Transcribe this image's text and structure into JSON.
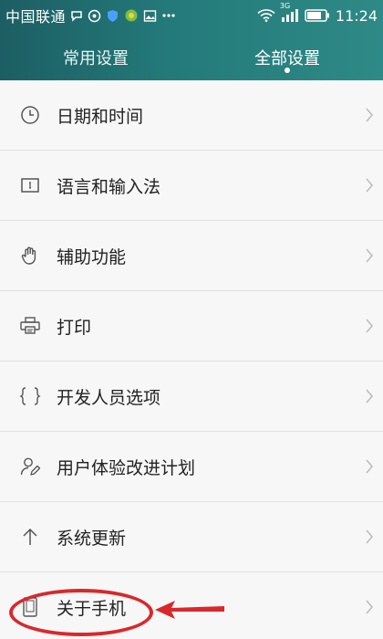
{
  "status_bar": {
    "carrier": "中国联通",
    "network": "3G",
    "time": "11:24"
  },
  "tabs": [
    {
      "label": "常用设置",
      "active": false
    },
    {
      "label": "全部设置",
      "active": true
    }
  ],
  "settings_list": [
    {
      "label": "日期和时间",
      "icon": "clock-icon"
    },
    {
      "label": "语言和输入法",
      "icon": "keyboard-icon"
    },
    {
      "label": "辅助功能",
      "icon": "hand-icon"
    },
    {
      "label": "打印",
      "icon": "printer-icon"
    },
    {
      "label": "开发人员选项",
      "icon": "braces-icon"
    },
    {
      "label": "用户体验改进计划",
      "icon": "user-edit-icon"
    },
    {
      "label": "系统更新",
      "icon": "arrow-up-icon"
    },
    {
      "label": "关于手机",
      "icon": "phone-icon"
    }
  ],
  "colors": {
    "header_start": "#1c5e63",
    "header_end": "#2e8a86",
    "annotation": "#d9282c"
  }
}
